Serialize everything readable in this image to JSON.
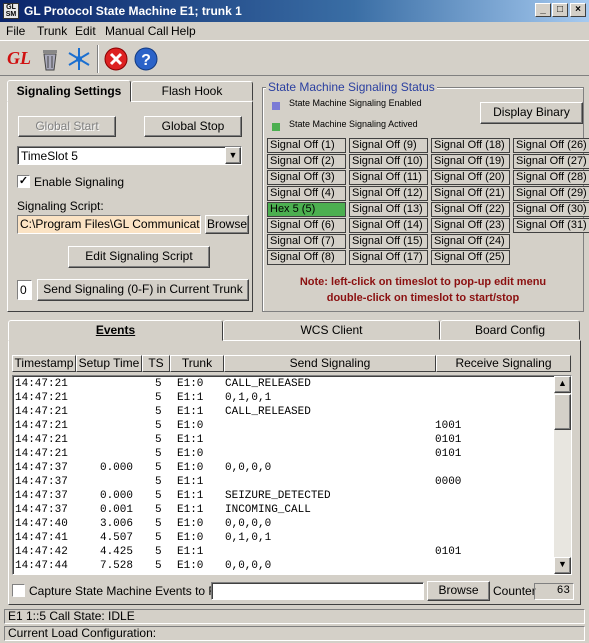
{
  "window": {
    "title": "GL Protocol State Machine  E1; trunk 1",
    "icon_text": "GL SM"
  },
  "menu": [
    "File",
    "Trunk",
    "Edit",
    "Manual Call",
    "Help"
  ],
  "toolbar": {
    "icons": [
      "gl-logo-icon",
      "trash-icon",
      "snowflake-icon",
      "stop-icon",
      "help-icon"
    ],
    "gl_text": "GL"
  },
  "left_tabs": {
    "active": "Signaling Settings",
    "other": "Flash Hook"
  },
  "settings": {
    "global_start": "Global Start",
    "global_stop": "Global Stop",
    "timeslot_value": "TimeSlot 5",
    "enable_signaling_label": "Enable Signaling",
    "enable_signaling_checked": true,
    "script_label": "Signaling Script:",
    "script_value": "C:\\Program Files\\GL Communications",
    "browse": "Browse",
    "edit_script": "Edit Signaling Script",
    "send_value": "0",
    "send_button": "Send Signaling (0-F) in Current Trunk"
  },
  "status_panel": {
    "title": "State Machine Signaling Status",
    "legend_enabled": "State Machine Signaling Enabled",
    "legend_actived": "State Machine Signaling Actived",
    "display_binary": "Display Binary",
    "colors": {
      "enabled": "#7b7bd6",
      "actived": "#4caf50"
    },
    "columns": [
      [
        "Signal Off (1)",
        "Signal Off (2)",
        "Signal Off (3)",
        "Signal Off (4)",
        "Hex 5 (5)",
        "Signal Off (6)",
        "Signal Off (7)",
        "Signal Off (8)"
      ],
      [
        "Signal Off (9)",
        "Signal Off (10)",
        "Signal Off (11)",
        "Signal Off (12)",
        "Signal Off (13)",
        "Signal Off (14)",
        "Signal Off (15)",
        "Signal Off (17)"
      ],
      [
        "Signal Off (18)",
        "Signal Off (19)",
        "Signal Off (20)",
        "Signal Off (21)",
        "Signal Off (22)",
        "Signal Off (23)",
        "Signal Off (24)",
        "Signal Off (25)"
      ],
      [
        "Signal Off (26)",
        "Signal Off (27)",
        "Signal Off (28)",
        "Signal Off (29)",
        "Signal Off (30)",
        "Signal Off (31)"
      ]
    ],
    "note_line1": "Note: left-click on timeslot to pop-up edit menu",
    "note_line2": "double-click on timeslot to start/stop"
  },
  "bottom_tabs": [
    "Events",
    "WCS Client",
    "Board Config"
  ],
  "events": {
    "headers": [
      "Timestamp",
      "Setup Time",
      "TS",
      "Trunk",
      "Send Signaling",
      "Receive Signaling"
    ],
    "rows": [
      [
        "14:47:21",
        "",
        "5",
        "E1:0",
        "CALL_RELEASED",
        ""
      ],
      [
        "14:47:21",
        "",
        "5",
        "E1:1",
        "0,1,0,1",
        ""
      ],
      [
        "14:47:21",
        "",
        "5",
        "E1:1",
        "CALL_RELEASED",
        ""
      ],
      [
        "14:47:21",
        "",
        "5",
        "E1:0",
        "",
        "1001"
      ],
      [
        "14:47:21",
        "",
        "5",
        "E1:1",
        "",
        "0101"
      ],
      [
        "14:47:21",
        "",
        "5",
        "E1:0",
        "",
        "0101"
      ],
      [
        "14:47:37",
        "0.000",
        "5",
        "E1:0",
        "0,0,0,0",
        ""
      ],
      [
        "14:47:37",
        "",
        "5",
        "E1:1",
        "",
        "0000"
      ],
      [
        "14:47:37",
        "0.000",
        "5",
        "E1:1",
        "SEIZURE_DETECTED",
        ""
      ],
      [
        "14:47:37",
        "0.001",
        "5",
        "E1:1",
        "INCOMING_CALL",
        ""
      ],
      [
        "14:47:40",
        "3.006",
        "5",
        "E1:0",
        "0,0,0,0",
        ""
      ],
      [
        "14:47:41",
        "4.507",
        "5",
        "E1:0",
        "0,1,0,1",
        ""
      ],
      [
        "14:47:42",
        "4.425",
        "5",
        "E1:1",
        "",
        "0101"
      ],
      [
        "14:47:44",
        "7.528",
        "5",
        "E1:0",
        "0,0,0,0",
        ""
      ]
    ],
    "capture_label": "Capture State Machine Events to File",
    "capture_value": "",
    "browse": "Browse",
    "counter_label": "Counter",
    "counter_value": "63"
  },
  "status": {
    "line1": "E1 1::5 Call State: IDLE",
    "line2": "Current Load Configuration:"
  }
}
